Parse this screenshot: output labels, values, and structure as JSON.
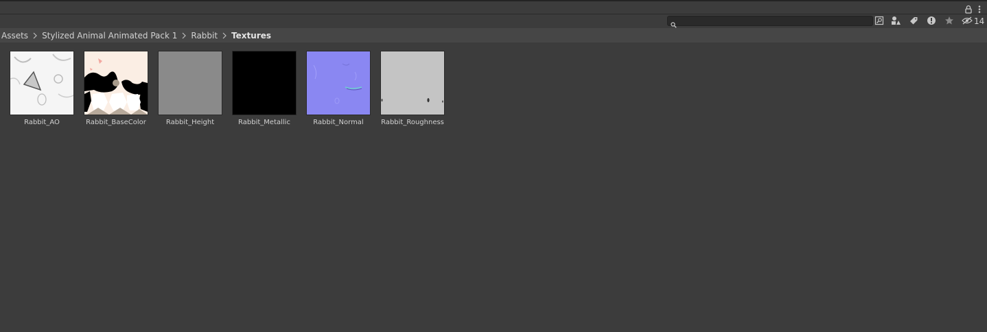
{
  "toolbar": {
    "search_value": "",
    "hidden_count": "14"
  },
  "breadcrumb": {
    "items": [
      "Assets",
      "Stylized Animal Animated Pack 1",
      "Rabbit"
    ],
    "current": "Textures"
  },
  "assets": [
    {
      "name": "Rabbit_AO"
    },
    {
      "name": "Rabbit_BaseColor"
    },
    {
      "name": "Rabbit_Height"
    },
    {
      "name": "Rabbit_Metallic"
    },
    {
      "name": "Rabbit_Normal"
    },
    {
      "name": "Rabbit_Roughness"
    }
  ],
  "colors": {
    "panel_bg": "#3c3c3c",
    "breadcrumb_bg": "#464646",
    "text": "#d2d2d2",
    "height_map": "#8a8a8a",
    "metallic_map": "#000000",
    "normal_map": "#8a87f2",
    "roughness_map": "#c4c4c4"
  },
  "icons": [
    "lock-icon",
    "kebab-menu-icon",
    "search-icon",
    "search-by-type-icon",
    "filter-by-type-icon",
    "filter-by-label-icon",
    "filter-by-status-icon",
    "favorites-star-icon",
    "hidden-packages-eye-icon"
  ]
}
